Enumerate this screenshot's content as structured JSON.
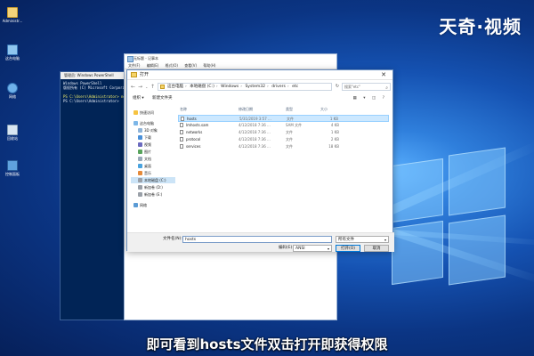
{
  "brand": "天奇·视频",
  "subtitle": "即可看到hosts文件双击打开即获得权限",
  "colors": {
    "accent": "#0078d7",
    "selection": "#cce8ff",
    "console": "#012456",
    "desktop": "#1552b2"
  },
  "desktop_icons": [
    {
      "label": "Administr...",
      "icon": "user-folder-icon"
    },
    {
      "label": "这台电脑",
      "icon": "computer-icon"
    },
    {
      "label": "网络",
      "icon": "network-icon"
    },
    {
      "label": "回收站",
      "icon": "recycle-bin-icon"
    },
    {
      "label": "控制面板",
      "icon": "control-panel-icon"
    }
  ],
  "powershell": {
    "title": "管理员: Windows PowerShell",
    "lines": [
      "Windows PowerShell",
      "版权所有 (C) Microsoft Corporatio",
      "",
      "PS C:\\Users\\Administrator> notep",
      "PS C:\\Users\\Administrator>"
    ]
  },
  "notepad": {
    "title": "无标题 - 记事本",
    "menu": [
      "文件(F)",
      "编辑(E)",
      "格式(O)",
      "查看(V)",
      "帮助(H)"
    ]
  },
  "dialog": {
    "title": "打开",
    "breadcrumb": [
      "这台电脑",
      "本地磁盘 (C:)",
      "Windows",
      "System32",
      "drivers",
      "etc"
    ],
    "search_placeholder": "搜索\"etc\"",
    "organize": "组织 ▾",
    "new_folder": "新建文件夹",
    "sidebar": [
      {
        "label": "快速访问",
        "icon": "star-icon"
      },
      {
        "label": "这台电脑",
        "icon": "computer-icon"
      },
      {
        "label": "3D 对象",
        "icon": "cube-icon"
      },
      {
        "label": "下载",
        "icon": "download-icon"
      },
      {
        "label": "视频",
        "icon": "video-icon"
      },
      {
        "label": "图片",
        "icon": "picture-icon"
      },
      {
        "label": "文档",
        "icon": "document-icon"
      },
      {
        "label": "桌面",
        "icon": "desktop-icon"
      },
      {
        "label": "音乐",
        "icon": "music-icon"
      },
      {
        "label": "本地磁盘 (C:)",
        "icon": "drive-icon"
      },
      {
        "label": "新加卷 (D:)",
        "icon": "drive-icon"
      },
      {
        "label": "新加卷 (E:)",
        "icon": "drive-icon"
      },
      {
        "label": "网络",
        "icon": "network-icon"
      }
    ],
    "columns": {
      "name": "名称",
      "date": "修改日期",
      "type": "类型",
      "size": "大小"
    },
    "files": [
      {
        "name": "hosts",
        "date": "5/31/2019 3:57 ...",
        "type": "文件",
        "size": "1 KB"
      },
      {
        "name": "lmhosts.sam",
        "date": "4/12/2018 7:36 ...",
        "type": "SAM 文件",
        "size": "4 KB"
      },
      {
        "name": "networks",
        "date": "4/12/2018 7:36 ...",
        "type": "文件",
        "size": "1 KB"
      },
      {
        "name": "protocol",
        "date": "4/12/2018 7:36 ...",
        "type": "文件",
        "size": "2 KB"
      },
      {
        "name": "services",
        "date": "4/12/2018 7:36 ...",
        "type": "文件",
        "size": "18 KB"
      }
    ],
    "filename_label": "文件名(N):",
    "filename_value": "hosts",
    "filetype_value": "所有文件",
    "encoding_label": "编码(E):",
    "encoding_value": "ANSI",
    "open_label": "打开(O)",
    "cancel_label": "取消"
  }
}
